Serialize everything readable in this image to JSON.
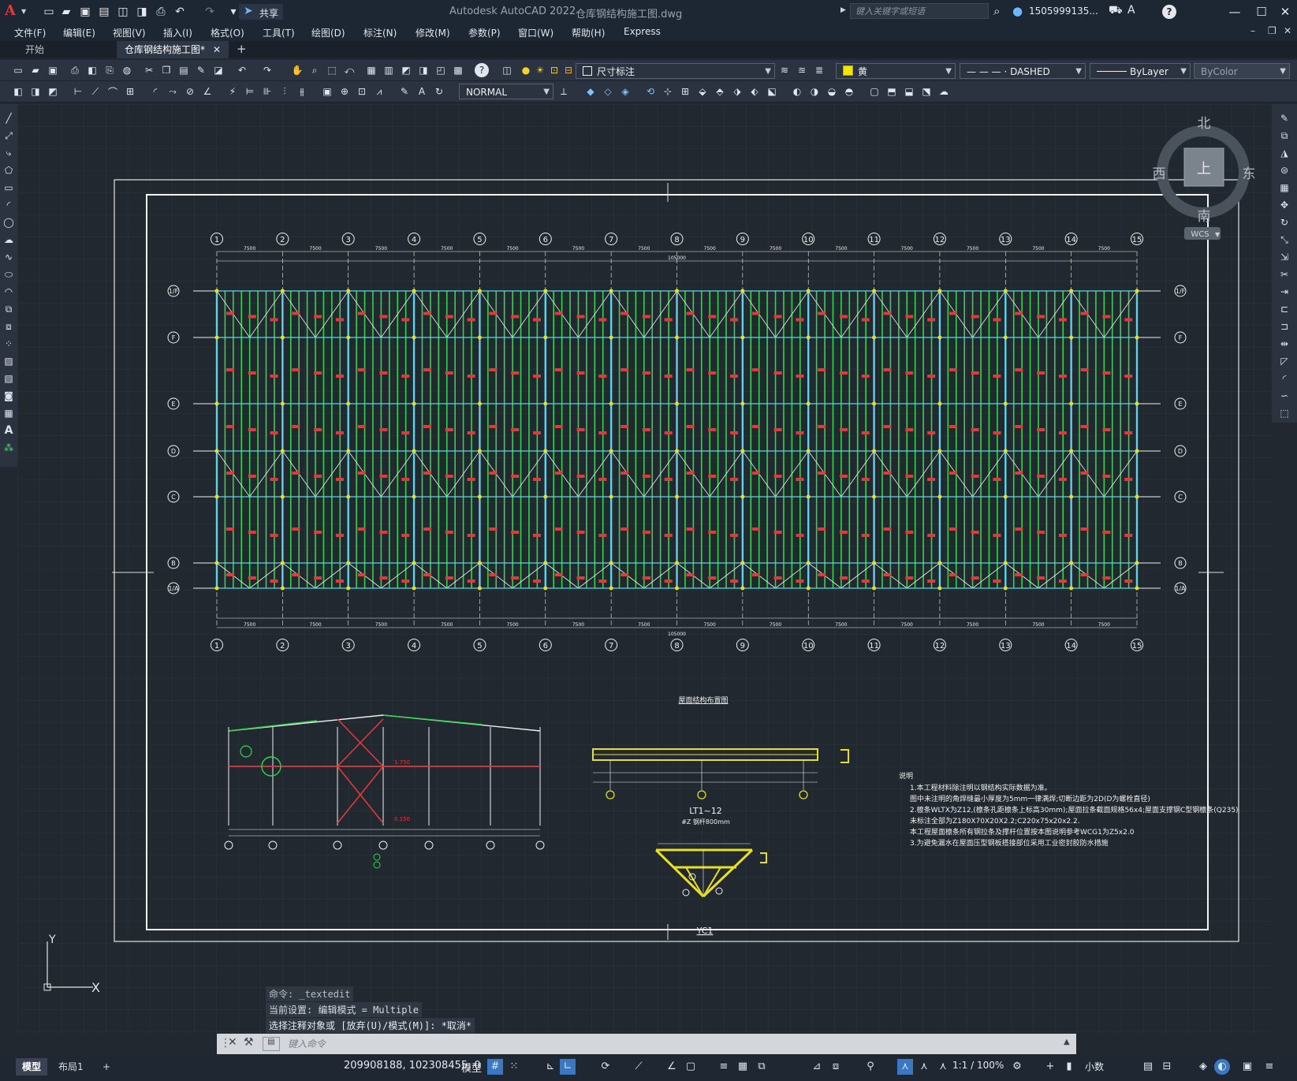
{
  "app": {
    "logo": "A",
    "title": "Autodesk AutoCAD 2022",
    "file": "仓库钢结构施工图.dwg",
    "share_label": "共享",
    "search_placeholder": "键入关键字或短语",
    "user": "1505999135..."
  },
  "menu": [
    "文件(F)",
    "编辑(E)",
    "视图(V)",
    "插入(I)",
    "格式(O)",
    "工具(T)",
    "绘图(D)",
    "标注(N)",
    "修改(M)",
    "参数(P)",
    "窗口(W)",
    "帮助(H)",
    "Express"
  ],
  "tabs": {
    "start": "开始",
    "doc": "仓库钢结构施工图*"
  },
  "toolbar": {
    "dimension_style": "尺寸标注",
    "color": "黄",
    "linetype": "— — — · DASHED",
    "lineweight": "ByLayer",
    "plotstyle": "ByColor",
    "text_style": "NORMAL"
  },
  "viewcube": {
    "north": "北",
    "south": "南",
    "east": "东",
    "west": "西",
    "top": "上",
    "wcs": "WCS"
  },
  "drawing": {
    "grid_cols": [
      "1",
      "2",
      "3",
      "4",
      "5",
      "6",
      "7",
      "8",
      "9",
      "10",
      "11",
      "12",
      "13",
      "14",
      "15"
    ],
    "grid_rows": [
      "1/F",
      "F",
      "E",
      "D",
      "C",
      "B",
      "1/A"
    ],
    "bay_dim": "7500",
    "total_dim": "105000",
    "plan_title": "屋面结构布置图",
    "truss_label": "LT1~12",
    "truss_sub": "#Z 钢杆800mm",
    "yc_label": "YC1",
    "notes_title": "说明",
    "notes": [
      "1.本工程材料除注明以钢结构实际数据为准。",
      "   图中未注明的角焊缝最小厚度为5mm一律满焊;切断边距为2D(D为螺栓直径)",
      "2.檩条WLTX为Z12,(檩条孔距檩条上标高30mm);屋面拉条截面规格56x4;屋面支撑钢C型钢檩条(Q235)",
      "   未标注全部为Z180X70X20X2.2;C220x75x20x2.2.",
      "   本工程屋面檩条所有钢拉条及撑杆位置按本图说明参考WCG1为Z5x2.0",
      "3.为避免漏水在屋面压型钢板搭接部位采用工业密封胶防水措施"
    ],
    "section_labels": [
      "1.750",
      "0.150"
    ],
    "ucs_x": "X",
    "ucs_y": "Y"
  },
  "command": {
    "history": [
      "命令: _textedit",
      "当前设置: 编辑模式 = Multiple",
      "选择注释对象或 [放弃(U)/模式(M)]: *取消*"
    ],
    "placeholder": "键入命令"
  },
  "status": {
    "tab_model": "模型",
    "tab_layout": "布局1",
    "coords": "209908188, 102308455, 0",
    "model_label": "模型",
    "scale": "1:1 / 100%",
    "units": "小数"
  },
  "colors": {
    "accent_red": "#e03a3a",
    "grid_cyan": "#5ed4e6",
    "purlin_green": "#2fd64a",
    "bolt_yellow": "#e6df22",
    "line_white": "#f0f0f0"
  }
}
